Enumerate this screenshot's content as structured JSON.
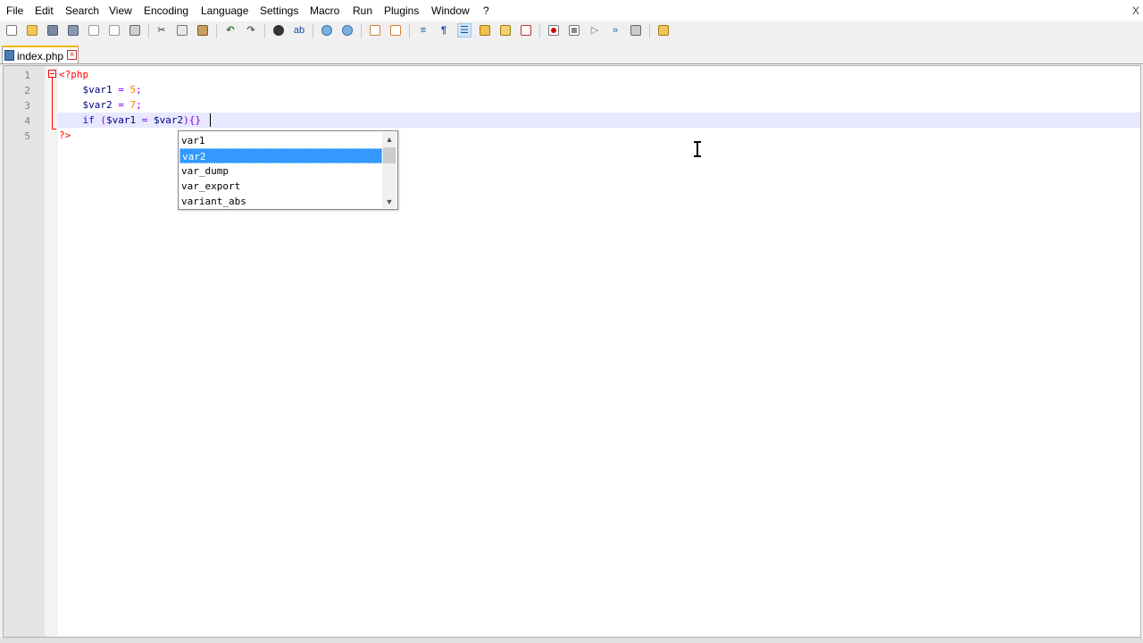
{
  "menu": {
    "items": [
      "File",
      "Edit",
      "Search",
      "View",
      "Encoding",
      "Language",
      "Settings",
      "Macro",
      "Run",
      "Plugins",
      "Window",
      "?"
    ],
    "close_label": "X"
  },
  "toolbar": {
    "icons": [
      "new-file-icon",
      "open-file-icon",
      "save-icon",
      "save-all-icon",
      "close-icon",
      "close-all-icon",
      "print-icon",
      "cut-icon",
      "copy-icon",
      "paste-icon",
      "undo-icon",
      "redo-icon",
      "find-icon",
      "replace-icon",
      "zoom-in-icon",
      "zoom-out-icon",
      "sync-vertical-icon",
      "sync-horizontal-icon",
      "word-wrap-icon",
      "show-all-chars-icon",
      "indent-guide-icon",
      "doc-map-icon",
      "function-list-icon",
      "folder-workspace-icon",
      "record-macro-icon",
      "stop-macro-icon",
      "play-macro-icon",
      "run-macro-multiple-icon",
      "save-macro-icon",
      "launch-browser-icon"
    ]
  },
  "tab": {
    "label": "index.php"
  },
  "editor": {
    "line_numbers": [
      "1",
      "2",
      "3",
      "4",
      "5"
    ],
    "line1": "<?php",
    "line2_var": "$var1",
    "line2_op": " = ",
    "line2_num": "5",
    "line2_end": ";",
    "line3_var": "$var2",
    "line3_op": " = ",
    "line3_num": "7",
    "line3_end": ";",
    "line4_kw": "if",
    "line4_open": " (",
    "line4_var1": "$var1",
    "line4_eq": " = ",
    "line4_var2": "$var2",
    "line4_close": ")",
    "line4_braces": "{}",
    "line5": "?>"
  },
  "autocomplete": {
    "items": [
      "var1",
      "var2",
      "var_dump",
      "var_export",
      "variant_abs"
    ],
    "selected_index": 1,
    "up_arrow": "^",
    "down_arrow": "v"
  },
  "colors": {
    "keyword": "#0000ff",
    "php_tag": "#ff0000",
    "number": "#ff8000",
    "operator": "#8000ff",
    "selection": "#3399ff",
    "current_line": "#e8e8ff"
  }
}
